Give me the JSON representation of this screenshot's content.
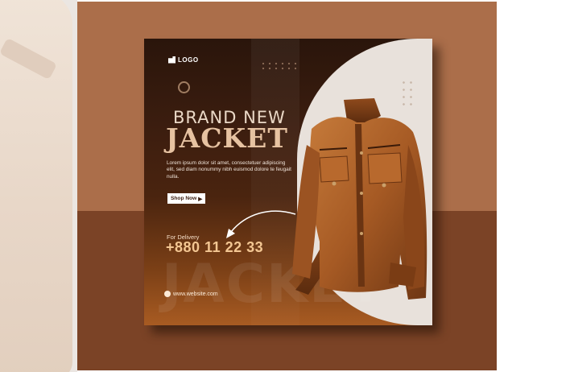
{
  "poster": {
    "logo_text": "LOGO",
    "headline_line1": "BRAND NEW",
    "headline_line2": "JACKET",
    "body_text": "Lorem ipsum dolor sit amet, consectetuer adipiscing elit, sed diam nonummy nibh euismod dolore te feugait nulla.",
    "cta_label": "Shop Now",
    "cta_icon": "triangle-right-icon",
    "delivery_label": "For Delivery",
    "phone": "+880 11 22 33",
    "ghost_word": "JACKET",
    "website": "www.website.com",
    "website_icon": "globe-icon"
  },
  "colors": {
    "page_bg": "#ffffff",
    "stage_upper": "#ab6e4a",
    "stage_lower": "#7b4326",
    "poster_dark": "#2a150b",
    "poster_warm": "#a85b22",
    "disc": "#e8e1db",
    "headline": "#e6c2a1",
    "phone": "#f3c692",
    "jacket_leather": "#a65a24"
  }
}
